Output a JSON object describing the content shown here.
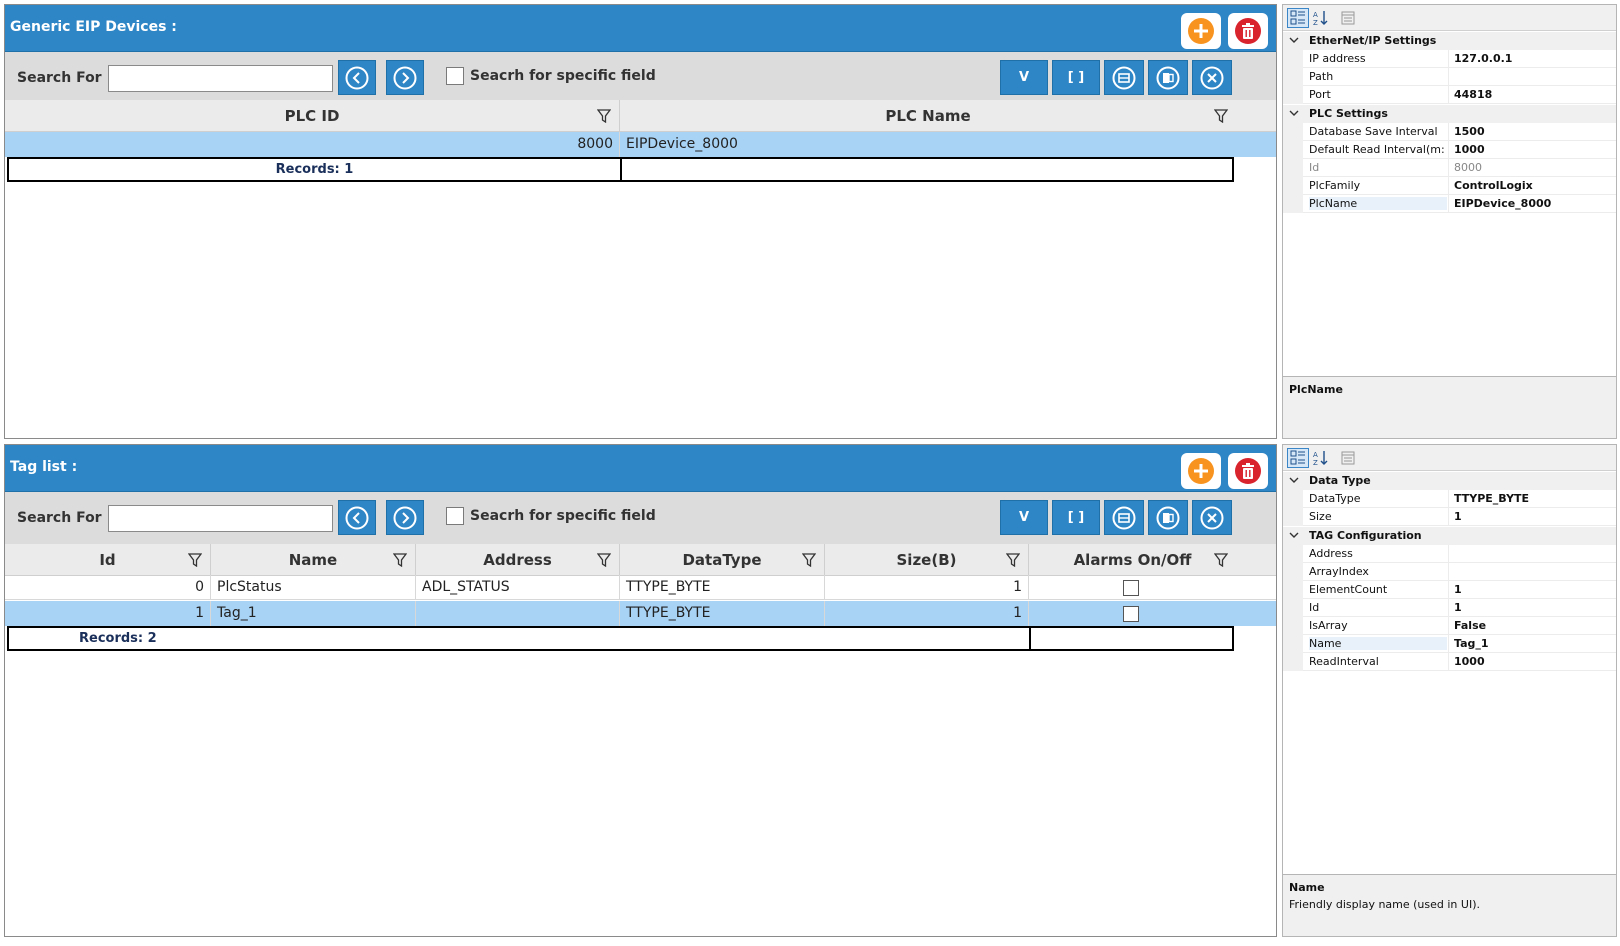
{
  "devices": {
    "title": "Generic EIP Devices :",
    "search_label": "Search For",
    "search_value": "",
    "specific_field_label": "Seacrh for specific field",
    "toolbar": {
      "v_label": "V",
      "bracket_label": "[ ]"
    },
    "columns": [
      "PLC ID",
      "PLC Name"
    ],
    "rows": [
      {
        "plc_id": "8000",
        "plc_name": "EIPDevice_8000"
      }
    ],
    "records": "Records: 1"
  },
  "tags": {
    "title": "Tag list :",
    "search_label": "Search For",
    "search_value": "",
    "specific_field_label": "Seacrh for specific field",
    "toolbar": {
      "v_label": "V",
      "bracket_label": "[ ]"
    },
    "columns": [
      "Id",
      "Name",
      "Address",
      "DataType",
      "Size(B)",
      "Alarms On/Off"
    ],
    "rows": [
      {
        "id": "0",
        "name": "PlcStatus",
        "address": "ADL_STATUS",
        "datatype": "TTYPE_BYTE",
        "size": "1",
        "alarms": false
      },
      {
        "id": "1",
        "name": "Tag_1",
        "address": "",
        "datatype": "TTYPE_BYTE",
        "size": "1",
        "alarms": false
      }
    ],
    "records": "Records: 2"
  },
  "prop1": {
    "categories": [
      {
        "name": "EtherNet/IP Settings",
        "items": [
          {
            "key": "IP address",
            "value": "127.0.0.1"
          },
          {
            "key": "Path",
            "value": ""
          },
          {
            "key": "Port",
            "value": "44818"
          }
        ]
      },
      {
        "name": "PLC Settings",
        "items": [
          {
            "key": "Database Save Interval",
            "value": "1500"
          },
          {
            "key": "Default Read Interval(m:",
            "value": "1000"
          },
          {
            "key": "Id",
            "value": "8000"
          },
          {
            "key": "PlcFamily",
            "value": "ControlLogix"
          },
          {
            "key": "PlcName",
            "value": "EIPDevice_8000"
          }
        ]
      }
    ],
    "desc_title": "PlcName",
    "desc_text": ""
  },
  "prop2": {
    "categories": [
      {
        "name": "Data Type",
        "items": [
          {
            "key": "DataType",
            "value": "TTYPE_BYTE"
          },
          {
            "key": "Size",
            "value": "1"
          }
        ]
      },
      {
        "name": "TAG Configuration",
        "items": [
          {
            "key": "Address",
            "value": ""
          },
          {
            "key": "ArrayIndex",
            "value": ""
          },
          {
            "key": "ElementCount",
            "value": "1"
          },
          {
            "key": "Id",
            "value": "1"
          },
          {
            "key": "IsArray",
            "value": "False"
          },
          {
            "key": "Name",
            "value": "Tag_1"
          },
          {
            "key": "ReadInterval",
            "value": "1000"
          }
        ]
      }
    ],
    "desc_title": "Name",
    "desc_text": "Friendly display name (used in UI)."
  },
  "colors": {
    "header": "#2f86c6",
    "selected_row": "#a9d3f5",
    "add": "#f7931e",
    "delete": "#d9232d"
  }
}
